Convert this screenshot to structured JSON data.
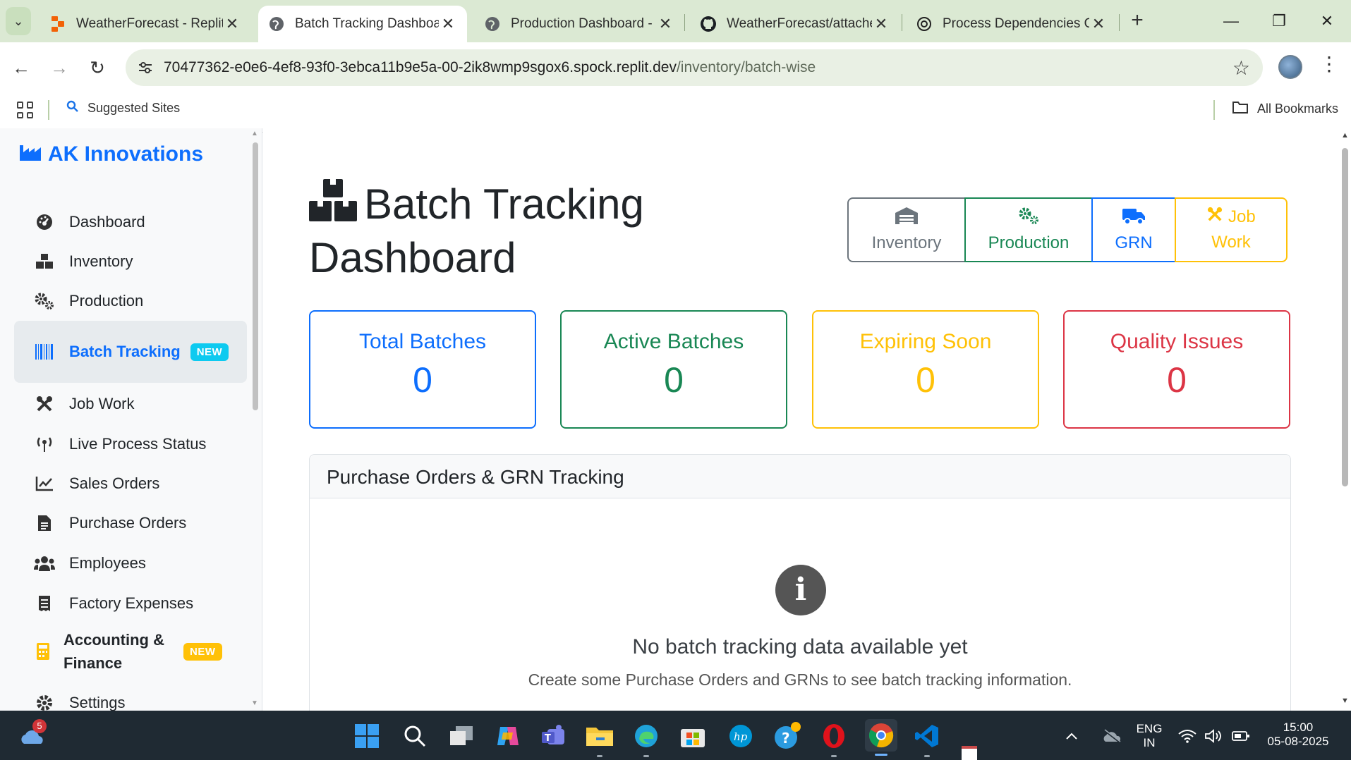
{
  "browser": {
    "tabs": [
      {
        "title": "WeatherForecast - Replit",
        "icon": "replit-icon",
        "active": false
      },
      {
        "title": "Batch Tracking Dashboard",
        "icon": "globe-icon",
        "active": true
      },
      {
        "title": "Production Dashboard - I",
        "icon": "globe-icon",
        "active": false
      },
      {
        "title": "WeatherForecast/attache",
        "icon": "github-icon",
        "active": false
      },
      {
        "title": "Process Dependencies Ov",
        "icon": "chatgpt-icon",
        "active": false
      }
    ],
    "url_host": "70477362-e0e6-4ef8-93f0-3ebca11b9e5a-00-2ik8wmp9sgox6.spock.replit.dev",
    "url_path": "/inventory/batch-wise",
    "bookmarks": {
      "suggested": "Suggested Sites",
      "all": "All Bookmarks"
    }
  },
  "sidebar": {
    "brand": "AK Innovations",
    "items": [
      {
        "label": "Dashboard",
        "icon": "gauge-icon"
      },
      {
        "label": "Inventory",
        "icon": "boxes-icon"
      },
      {
        "label": "Production",
        "icon": "gears-icon"
      },
      {
        "label": "Batch Tracking",
        "icon": "barcode-icon",
        "badge": "NEW",
        "active": true
      },
      {
        "label": "Job Work",
        "icon": "tools-icon"
      },
      {
        "label": "Live Process Status",
        "icon": "broadcast-icon"
      },
      {
        "label": "Sales Orders",
        "icon": "chart-line-icon"
      },
      {
        "label": "Purchase Orders",
        "icon": "file-icon"
      },
      {
        "label": "Employees",
        "icon": "users-icon"
      },
      {
        "label": "Factory Expenses",
        "icon": "receipt-icon"
      },
      {
        "label": "Accounting & Finance",
        "icon": "calculator-icon",
        "badge": "NEW"
      },
      {
        "label": "Settings",
        "icon": "gear-icon"
      }
    ]
  },
  "main": {
    "title": "Batch Tracking Dashboard",
    "quick_links": [
      {
        "label": "Inventory",
        "icon": "warehouse-icon"
      },
      {
        "label": "Production",
        "icon": "gears-icon"
      },
      {
        "label": "GRN",
        "icon": "truck-icon"
      },
      {
        "label": "Job Work",
        "icon": "tools-icon"
      }
    ],
    "stats": [
      {
        "label": "Total Batches",
        "value": "0",
        "color": "#0d6efd"
      },
      {
        "label": "Active Batches",
        "value": "0",
        "color": "#198754"
      },
      {
        "label": "Expiring Soon",
        "value": "0",
        "color": "#ffc107"
      },
      {
        "label": "Quality Issues",
        "value": "0",
        "color": "#dc3545"
      }
    ],
    "section": {
      "title": "Purchase Orders & GRN Tracking",
      "empty_icon": "info-circle-icon",
      "empty_title": "No batch tracking data available yet",
      "empty_text": "Create some Purchase Orders and GRNs to see batch tracking information."
    }
  },
  "taskbar": {
    "weather_badge": "5",
    "lang_line1": "ENG",
    "lang_line2": "IN",
    "time": "15:00",
    "date": "05-08-2025"
  }
}
